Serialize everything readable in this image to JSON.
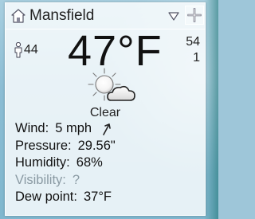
{
  "location": {
    "city": "Mansfield"
  },
  "current": {
    "temperature": "47°F",
    "feels_like": "44",
    "high": "54",
    "low": "1",
    "condition": "Clear"
  },
  "details": {
    "wind_label": "Wind:",
    "wind_value": "5 mph",
    "pressure_label": "Pressure:",
    "pressure_value": "29.56\"",
    "humidity_label": "Humidity:",
    "humidity_value": "68%",
    "visibility_label": "Visibility:",
    "visibility_value": "?",
    "dewpoint_label": "Dew point:",
    "dewpoint_value": "37°F"
  },
  "icons": {
    "home": "home-icon",
    "dropdown": "chevron-down-icon",
    "add": "plus-icon",
    "feels_like": "person-icon",
    "weather": "sun-cloud-icon",
    "wind_direction": "arrow-icon"
  },
  "colors": {
    "accent": "#1e7878",
    "text": "#222222",
    "dim": "#8a9aa3"
  }
}
